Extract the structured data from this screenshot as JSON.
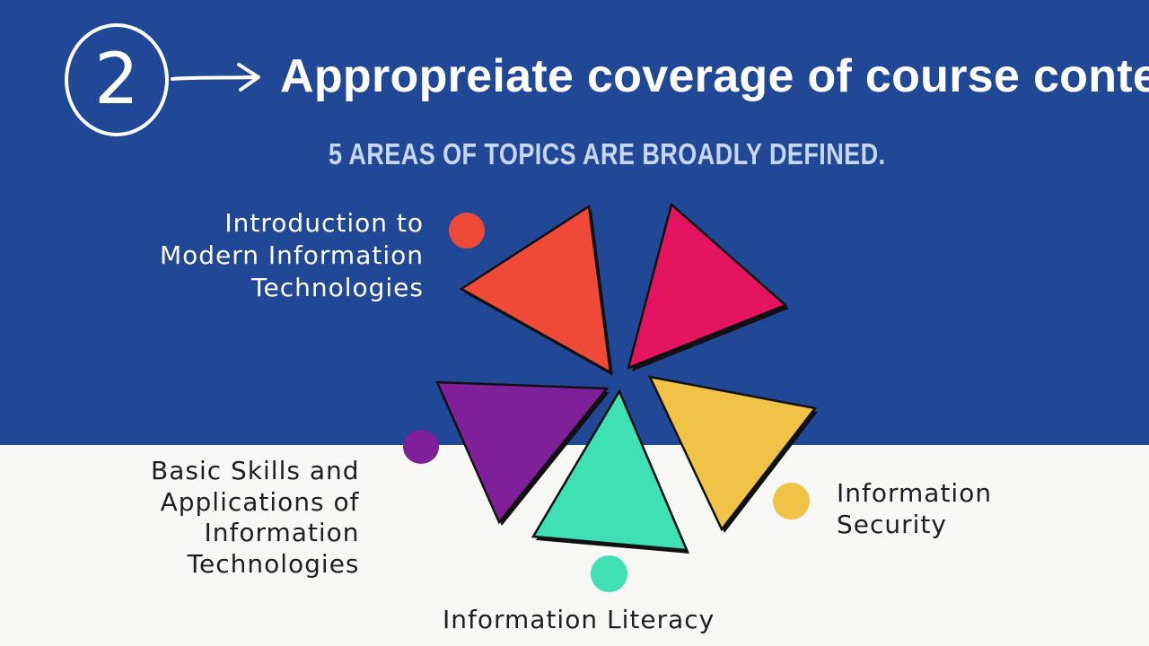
{
  "slide": {
    "number": "2",
    "title": "Appropreiate coverage of course content",
    "subtitle": "5 AREAS OF TOPICS ARE BROADLY DEFINED."
  },
  "topics": [
    {
      "id": "intro",
      "label": "Introduction to\nModern Information\nTechnologies",
      "color": "#ef4a37",
      "icon": "dot"
    },
    {
      "id": "unlabeled-pink",
      "label": "",
      "color": "#e5145f",
      "icon": "dot"
    },
    {
      "id": "basic",
      "label": "Basic Skills and\nApplications of\n   Information\n   Technologies",
      "color": "#7f1f9a",
      "icon": "dot"
    },
    {
      "id": "literacy",
      "label": "Information Literacy",
      "color": "#3fe0b3",
      "icon": "dot"
    },
    {
      "id": "security",
      "label": "Information\nSecurity",
      "color": "#f0c245",
      "icon": "dot"
    }
  ],
  "colors": {
    "background_top": "#214897",
    "background_bottom": "#f7f8f6",
    "title_text": "#ffffff",
    "subtitle_text": "#c6d7f2",
    "label_dark": "#1e1e24",
    "outline": "#111111"
  }
}
